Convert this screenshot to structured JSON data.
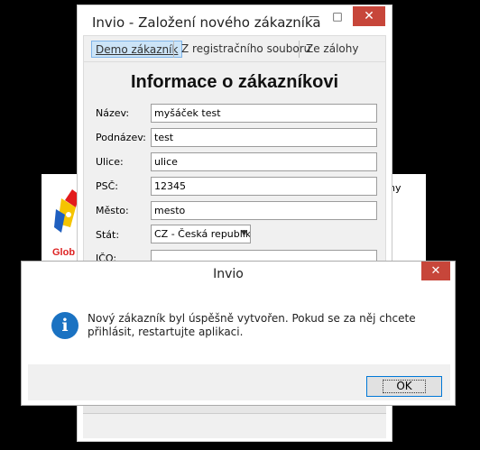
{
  "background_window": {
    "brand_text": "Glob",
    "partial_text": "ny"
  },
  "main_window": {
    "title": "Invio - Založení nového zákazníka",
    "tabs": [
      {
        "label": "Demo zákazník",
        "active": true
      },
      {
        "label": "Z registračního souboru",
        "active": false
      },
      {
        "label": "Ze zálohy",
        "active": false
      }
    ],
    "heading": "Informace o zákazníkovi",
    "fields": {
      "nazev": {
        "label": "Název:",
        "value": "myšáček test"
      },
      "podnazev": {
        "label": "Podnázev:",
        "value": "test"
      },
      "ulice": {
        "label": "Ulice:",
        "value": "ulice"
      },
      "psc": {
        "label": "PSČ:",
        "value": "12345"
      },
      "mesto": {
        "label": "Město:",
        "value": "mesto"
      },
      "stat": {
        "label": "Stát:",
        "value": "CZ - Česká republika"
      },
      "ico": {
        "label": "IČO:",
        "value": ""
      }
    }
  },
  "message_box": {
    "title": "Invio",
    "message": "Nový zákazník byl úspěšně vytvořen. Pokud se za něj chcete přihlásit, restartujte aplikaci.",
    "ok_label": "OK",
    "icon": "info-icon"
  },
  "colors": {
    "close_button": "#c7463a",
    "info_icon": "#1a72c2",
    "ok_focus_border": "#0078d7",
    "active_tab": "#cce4f7"
  }
}
